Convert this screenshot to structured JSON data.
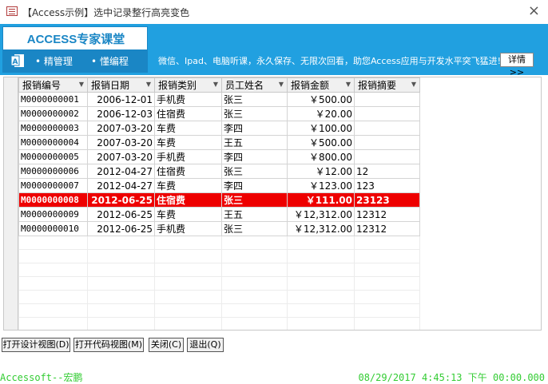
{
  "window": {
    "title": "【Access示例】选中记录整行高亮变色",
    "close_label": "×"
  },
  "banner": {
    "brand_title": "ACCESS专家课堂",
    "tag1": "• 精管理",
    "tag2": "• 懂编程",
    "message": "微信、Ipad、电脑听课，永久保存、无限次回看，助您Access应用与开发水平突飞猛进!",
    "detail_label": "详情>>",
    "colors": {
      "banner": "#21a0e0",
      "brand": "#1a86c5"
    }
  },
  "grid": {
    "columns": [
      {
        "label": "报销编号"
      },
      {
        "label": "报销日期"
      },
      {
        "label": "报销类别"
      },
      {
        "label": "员工姓名"
      },
      {
        "label": "报销金额"
      },
      {
        "label": "报销摘要"
      }
    ],
    "rows": [
      {
        "id": "M0000000001",
        "date": "2006-12-01",
        "type": "手机费",
        "name": "张三",
        "amount": "￥500.00",
        "memo": ""
      },
      {
        "id": "M0000000002",
        "date": "2006-12-03",
        "type": "住宿费",
        "name": "张三",
        "amount": "￥20.00",
        "memo": ""
      },
      {
        "id": "M0000000003",
        "date": "2007-03-20",
        "type": "车费",
        "name": "李四",
        "amount": "￥100.00",
        "memo": ""
      },
      {
        "id": "M0000000004",
        "date": "2007-03-20",
        "type": "车费",
        "name": "王五",
        "amount": "￥500.00",
        "memo": ""
      },
      {
        "id": "M0000000005",
        "date": "2007-03-20",
        "type": "手机费",
        "name": "李四",
        "amount": "￥800.00",
        "memo": ""
      },
      {
        "id": "M0000000006",
        "date": "2012-04-27",
        "type": "住宿费",
        "name": "张三",
        "amount": "￥12.00",
        "memo": "12"
      },
      {
        "id": "M0000000007",
        "date": "2012-04-27",
        "type": "车费",
        "name": "李四",
        "amount": "￥123.00",
        "memo": "123"
      },
      {
        "id": "M0000000008",
        "date": "2012-06-25",
        "type": "住宿费",
        "name": "张三",
        "amount": "￥111.00",
        "memo": "23123"
      },
      {
        "id": "M0000000009",
        "date": "2012-06-25",
        "type": "车费",
        "name": "王五",
        "amount": "￥12,312.00",
        "memo": "12312"
      },
      {
        "id": "M0000000010",
        "date": "2012-06-25",
        "type": "手机费",
        "name": "张三",
        "amount": "￥12,312.00",
        "memo": "12312"
      }
    ],
    "selected_index": 7,
    "highlight_color": "#ee0000"
  },
  "buttons": {
    "design": "打开设计视图(D)",
    "code": "打开代码视图(M)",
    "close": "关闭(C)",
    "exit": "退出(Q)"
  },
  "footer": {
    "left": "Accessoft--宏鹏",
    "right": "08/29/2017 4:45:13 下午 00:00.000"
  }
}
